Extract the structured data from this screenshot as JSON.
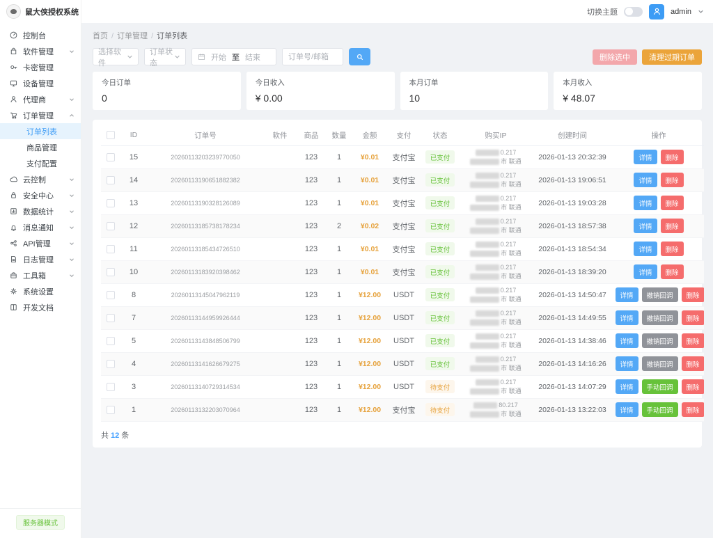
{
  "app": {
    "logo_text": "鼠大侠授权系统"
  },
  "header": {
    "theme_toggle_label": "切换主题",
    "username": "admin"
  },
  "sidebar": {
    "items": [
      {
        "key": "dashboard",
        "label": "控制台"
      },
      {
        "key": "software",
        "label": "软件管理",
        "chevron": "down"
      },
      {
        "key": "cardkey",
        "label": "卡密管理"
      },
      {
        "key": "device",
        "label": "设备管理"
      },
      {
        "key": "agent",
        "label": "代理商",
        "chevron": "down"
      },
      {
        "key": "order",
        "label": "订单管理",
        "chevron": "up",
        "children": [
          {
            "key": "order-list",
            "label": "订单列表",
            "active": true
          },
          {
            "key": "product-manage",
            "label": "商品管理"
          },
          {
            "key": "pay-config",
            "label": "支付配置"
          }
        ]
      },
      {
        "key": "cloud",
        "label": "云控制",
        "chevron": "down"
      },
      {
        "key": "security",
        "label": "安全中心",
        "chevron": "down"
      },
      {
        "key": "statistics",
        "label": "数据统计",
        "chevron": "down"
      },
      {
        "key": "notification",
        "label": "消息通知",
        "chevron": "down"
      },
      {
        "key": "api",
        "label": "API管理",
        "chevron": "down"
      },
      {
        "key": "log",
        "label": "日志管理",
        "chevron": "down"
      },
      {
        "key": "toolbox",
        "label": "工具箱",
        "chevron": "down"
      },
      {
        "key": "settings",
        "label": "系统设置"
      },
      {
        "key": "docs",
        "label": "开发文档"
      }
    ],
    "mode_badge": "服务器模式"
  },
  "breadcrumb": [
    "首页",
    "订单管理",
    "订单列表"
  ],
  "filters": {
    "software_select": "选择软件",
    "status_select": "订单状态",
    "date_start": "开始",
    "date_separator": "至",
    "date_end": "结束",
    "search_placeholder": "订单号/邮箱"
  },
  "toolbar": {
    "delete_selected": "删除选中",
    "clean_expired": "清理过期订单"
  },
  "stats": [
    {
      "label": "今日订单",
      "value": "0"
    },
    {
      "label": "今日收入",
      "value": "¥ 0.00"
    },
    {
      "label": "本月订单",
      "value": "10"
    },
    {
      "label": "本月收入",
      "value": "¥ 48.07"
    }
  ],
  "table": {
    "columns": [
      "ID",
      "订单号",
      "软件",
      "商品",
      "数量",
      "金额",
      "支付",
      "状态",
      "购买IP",
      "创建时间",
      "操作"
    ],
    "rows": [
      {
        "id": "15",
        "order_no": "20260113203239770050",
        "software": "",
        "product": "123",
        "quantity": "1",
        "amount": "¥0.01",
        "payment": "支付宝",
        "status": "已支付",
        "status_type": "paid",
        "ip_suffix": "0.217",
        "location_suffix": "市 联通",
        "created": "2026-01-13 20:32:39",
        "actions": [
          {
            "name": "detail",
            "label": "详情",
            "type": "primary"
          },
          {
            "name": "delete",
            "label": "删除",
            "type": "danger"
          }
        ]
      },
      {
        "id": "14",
        "order_no": "20260113190651882382",
        "software": "",
        "product": "123",
        "quantity": "1",
        "amount": "¥0.01",
        "payment": "支付宝",
        "status": "已支付",
        "status_type": "paid",
        "ip_suffix": "0.217",
        "location_suffix": "市 联通",
        "created": "2026-01-13 19:06:51",
        "actions": [
          {
            "name": "detail",
            "label": "详情",
            "type": "primary"
          },
          {
            "name": "delete",
            "label": "删除",
            "type": "danger"
          }
        ]
      },
      {
        "id": "13",
        "order_no": "20260113190328126089",
        "software": "",
        "product": "123",
        "quantity": "1",
        "amount": "¥0.01",
        "payment": "支付宝",
        "status": "已支付",
        "status_type": "paid",
        "ip_suffix": "0.217",
        "location_suffix": "市 联通",
        "created": "2026-01-13 19:03:28",
        "actions": [
          {
            "name": "detail",
            "label": "详情",
            "type": "primary"
          },
          {
            "name": "delete",
            "label": "删除",
            "type": "danger"
          }
        ]
      },
      {
        "id": "12",
        "order_no": "20260113185738178234",
        "software": "",
        "product": "123",
        "quantity": "2",
        "amount": "¥0.02",
        "payment": "支付宝",
        "status": "已支付",
        "status_type": "paid",
        "ip_suffix": "0.217",
        "location_suffix": "市 联通",
        "created": "2026-01-13 18:57:38",
        "actions": [
          {
            "name": "detail",
            "label": "详情",
            "type": "primary"
          },
          {
            "name": "delete",
            "label": "删除",
            "type": "danger"
          }
        ]
      },
      {
        "id": "11",
        "order_no": "20260113185434726510",
        "software": "",
        "product": "123",
        "quantity": "1",
        "amount": "¥0.01",
        "payment": "支付宝",
        "status": "已支付",
        "status_type": "paid",
        "ip_suffix": "0.217",
        "location_suffix": "市 联通",
        "created": "2026-01-13 18:54:34",
        "actions": [
          {
            "name": "detail",
            "label": "详情",
            "type": "primary"
          },
          {
            "name": "delete",
            "label": "删除",
            "type": "danger"
          }
        ]
      },
      {
        "id": "10",
        "order_no": "20260113183920398462",
        "software": "",
        "product": "123",
        "quantity": "1",
        "amount": "¥0.01",
        "payment": "支付宝",
        "status": "已支付",
        "status_type": "paid",
        "ip_suffix": "0.217",
        "location_suffix": "市 联通",
        "created": "2026-01-13 18:39:20",
        "actions": [
          {
            "name": "detail",
            "label": "详情",
            "type": "primary"
          },
          {
            "name": "delete",
            "label": "删除",
            "type": "danger"
          }
        ]
      },
      {
        "id": "8",
        "order_no": "20260113145047962119",
        "software": "",
        "product": "123",
        "quantity": "1",
        "amount": "¥12.00",
        "payment": "USDT",
        "status": "已支付",
        "status_type": "paid",
        "ip_suffix": "0.217",
        "location_suffix": "市 联通",
        "created": "2026-01-13 14:50:47",
        "actions": [
          {
            "name": "detail",
            "label": "详情",
            "type": "primary"
          },
          {
            "name": "revoke-callback",
            "label": "撤销回调",
            "type": "info"
          },
          {
            "name": "delete",
            "label": "删除",
            "type": "danger"
          }
        ]
      },
      {
        "id": "7",
        "order_no": "20260113144959926444",
        "software": "",
        "product": "123",
        "quantity": "1",
        "amount": "¥12.00",
        "payment": "USDT",
        "status": "已支付",
        "status_type": "paid",
        "ip_suffix": "0.217",
        "location_suffix": "市 联通",
        "created": "2026-01-13 14:49:55",
        "actions": [
          {
            "name": "detail",
            "label": "详情",
            "type": "primary"
          },
          {
            "name": "revoke-callback",
            "label": "撤销回调",
            "type": "info"
          },
          {
            "name": "delete",
            "label": "删除",
            "type": "danger"
          }
        ]
      },
      {
        "id": "5",
        "order_no": "20260113143848506799",
        "software": "",
        "product": "123",
        "quantity": "1",
        "amount": "¥12.00",
        "payment": "USDT",
        "status": "已支付",
        "status_type": "paid",
        "ip_suffix": "0.217",
        "location_suffix": "市 联通",
        "created": "2026-01-13 14:38:46",
        "actions": [
          {
            "name": "detail",
            "label": "详情",
            "type": "primary"
          },
          {
            "name": "revoke-callback",
            "label": "撤销回调",
            "type": "info"
          },
          {
            "name": "delete",
            "label": "删除",
            "type": "danger"
          }
        ]
      },
      {
        "id": "4",
        "order_no": "20260113141626679275",
        "software": "",
        "product": "123",
        "quantity": "1",
        "amount": "¥12.00",
        "payment": "USDT",
        "status": "已支付",
        "status_type": "paid",
        "ip_suffix": "0.217",
        "location_suffix": "市 联通",
        "created": "2026-01-13 14:16:26",
        "actions": [
          {
            "name": "detail",
            "label": "详情",
            "type": "primary"
          },
          {
            "name": "revoke-callback",
            "label": "撤销回调",
            "type": "info"
          },
          {
            "name": "delete",
            "label": "删除",
            "type": "danger"
          }
        ]
      },
      {
        "id": "3",
        "order_no": "20260113140729314534",
        "software": "",
        "product": "123",
        "quantity": "1",
        "amount": "¥12.00",
        "payment": "USDT",
        "status": "待支付",
        "status_type": "pending",
        "ip_suffix": "0.217",
        "location_suffix": "市 联通",
        "created": "2026-01-13 14:07:29",
        "actions": [
          {
            "name": "detail",
            "label": "详情",
            "type": "primary"
          },
          {
            "name": "manual-callback",
            "label": "手动回调",
            "type": "success"
          },
          {
            "name": "delete",
            "label": "删除",
            "type": "danger"
          }
        ]
      },
      {
        "id": "1",
        "order_no": "20260113132203070964",
        "software": "",
        "product": "123",
        "quantity": "1",
        "amount": "¥12.00",
        "payment": "支付宝",
        "status": "待支付",
        "status_type": "pending",
        "ip_suffix": "80.217",
        "location_suffix": "市 联通",
        "created": "2026-01-13 13:22:03",
        "actions": [
          {
            "name": "detail",
            "label": "详情",
            "type": "primary"
          },
          {
            "name": "manual-callback",
            "label": "手动回调",
            "type": "success"
          },
          {
            "name": "delete",
            "label": "删除",
            "type": "danger"
          }
        ]
      }
    ]
  },
  "pagination": {
    "prefix": "共",
    "total": "12",
    "unit": "条"
  },
  "colors": {
    "accent": "#409eff",
    "danger": "#f56c6c",
    "success": "#67c23a",
    "warning": "#e6a23c",
    "info": "#909399",
    "paid_bg": "#f0f9eb",
    "pending_bg": "#fdf6ec",
    "content_bg": "#f0f2f5",
    "active_menu_bg": "#e6f3fd"
  }
}
